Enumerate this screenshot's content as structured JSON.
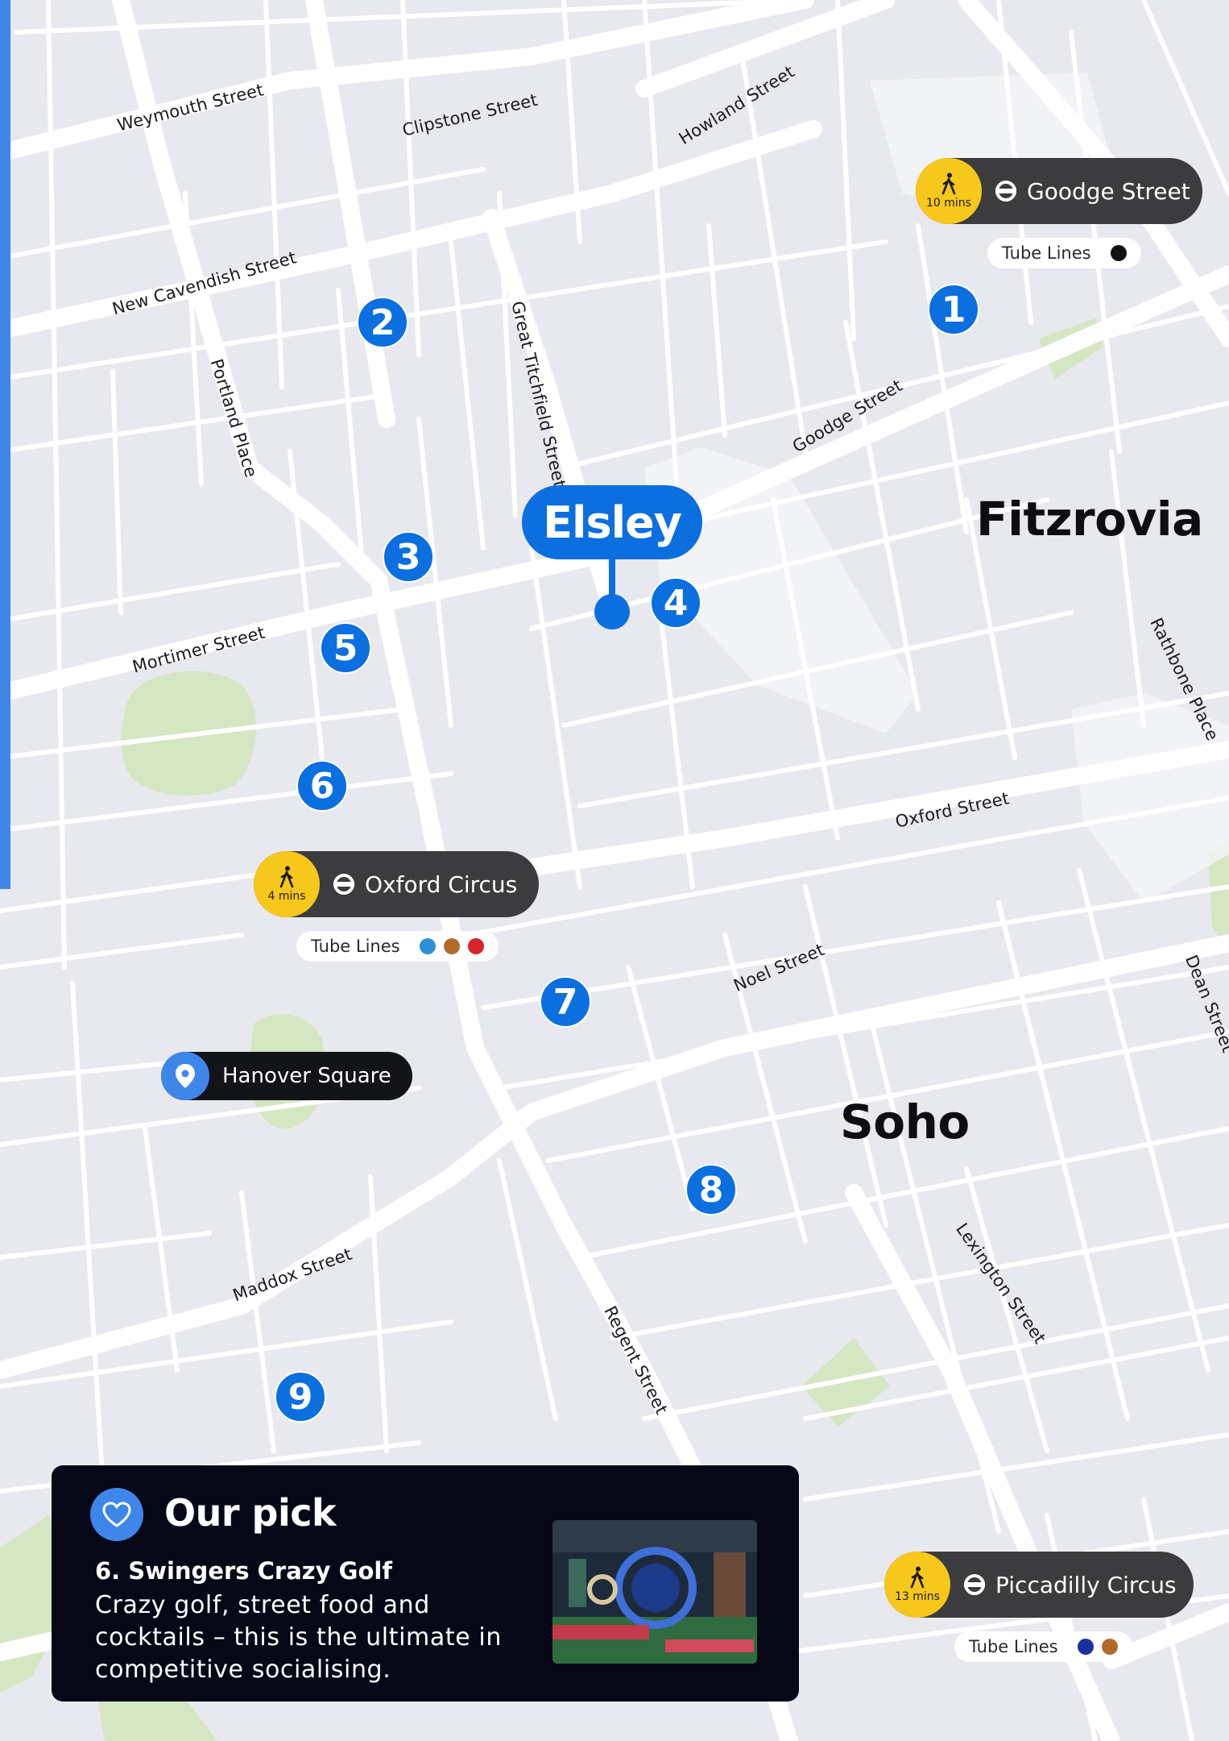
{
  "map": {
    "hotel": "Elsley",
    "areas": [
      "Fitzrovia",
      "Soho"
    ],
    "streets": [
      "Weymouth Street",
      "Clipstone Street",
      "Howland Street",
      "New Cavendish Street",
      "Great Titchfield Street",
      "Portland Place",
      "Goodge Street",
      "Mortimer Street",
      "Rathbone Place",
      "Oxford Street",
      "Noel Street",
      "Dean Street",
      "Maddox Street",
      "Regent Street",
      "Lexington Street"
    ],
    "markers": [
      "1",
      "2",
      "3",
      "4",
      "5",
      "6",
      "7",
      "8",
      "9"
    ],
    "stations": [
      {
        "name": "Goodge Street",
        "walk": "10 mins",
        "tube_label": "Tube Lines",
        "lines": [
          "#111111"
        ]
      },
      {
        "name": "Oxford Circus",
        "walk": "4 mins",
        "tube_label": "Tube Lines",
        "lines": [
          "#2d8fd6",
          "#b26a2a",
          "#d8232a"
        ]
      },
      {
        "name": "Piccadilly Circus",
        "walk": "13 mins",
        "tube_label": "Tube Lines",
        "lines": [
          "#1c2f9e",
          "#b26a2a"
        ]
      }
    ],
    "place": "Hanover Square",
    "colors": {
      "accent": "#0b6fe0",
      "walk": "#f7c81c",
      "park": "#d5e6c3",
      "card": "#060818"
    }
  },
  "pick": {
    "title": "Our pick",
    "name": "6. Swingers Crazy Golf",
    "description": "Crazy golf, street food and cocktails – this is the ultimate in competitive socialising."
  }
}
